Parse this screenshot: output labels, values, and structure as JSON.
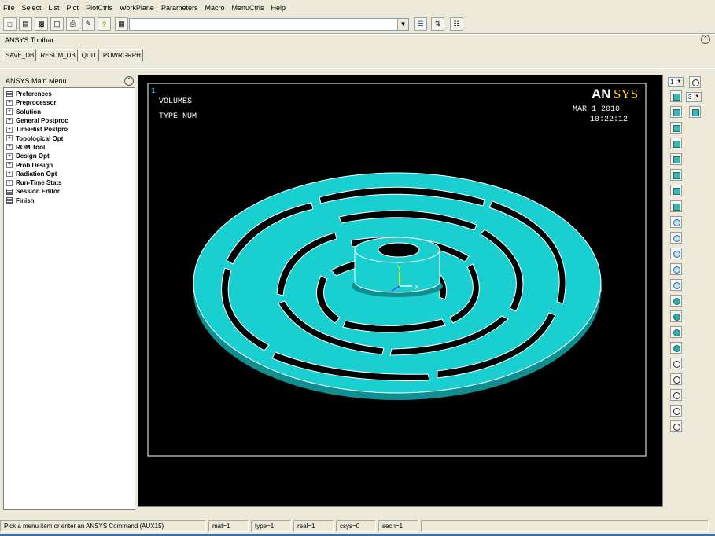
{
  "menu": [
    "File",
    "Select",
    "List",
    "Plot",
    "PlotCtrls",
    "WorkPlane",
    "Parameters",
    "Macro",
    "MenuCtrls",
    "Help"
  ],
  "command_input": {
    "value": ""
  },
  "ansys_toolbar": {
    "title": "ANSYS Toolbar",
    "buttons": [
      "SAVE_DB",
      "RESUM_DB",
      "QUIT",
      "POWRGRPH"
    ]
  },
  "main_menu": {
    "title": "ANSYS Main Menu",
    "items": [
      {
        "label": "Preferences",
        "icon": "doc"
      },
      {
        "label": "Preprocessor",
        "icon": "plus"
      },
      {
        "label": "Solution",
        "icon": "plus"
      },
      {
        "label": "General Postproc",
        "icon": "plus"
      },
      {
        "label": "TimeHist Postpro",
        "icon": "plus"
      },
      {
        "label": "Topological Opt",
        "icon": "plus"
      },
      {
        "label": "ROM Tool",
        "icon": "plus"
      },
      {
        "label": "Design Opt",
        "icon": "plus"
      },
      {
        "label": "Prob Design",
        "icon": "plus"
      },
      {
        "label": "Radiation Opt",
        "icon": "plus"
      },
      {
        "label": "Run-Time Stats",
        "icon": "plus"
      },
      {
        "label": "Session Editor",
        "icon": "doc"
      },
      {
        "label": "Finish",
        "icon": "doc"
      }
    ]
  },
  "graphics": {
    "window_number": "1",
    "label1": "VOLUMES",
    "label2": "TYPE NUM",
    "date": "MAR  1 2010",
    "time": "10:22:12",
    "logo_an": "AN",
    "logo_sys": "SYS",
    "axis_y": "Y",
    "axis_x": "X",
    "model_color": "#19cfcf",
    "background": "#000000"
  },
  "right_toolbar": {
    "window_select": "1",
    "view_select": "3"
  },
  "status": {
    "prompt": "Pick a menu item or enter an ANSYS Command (AUX15)",
    "mat": "mat=1",
    "type": "type=1",
    "real": "real=1",
    "csys": "csys=0",
    "secn": "secn=1"
  }
}
